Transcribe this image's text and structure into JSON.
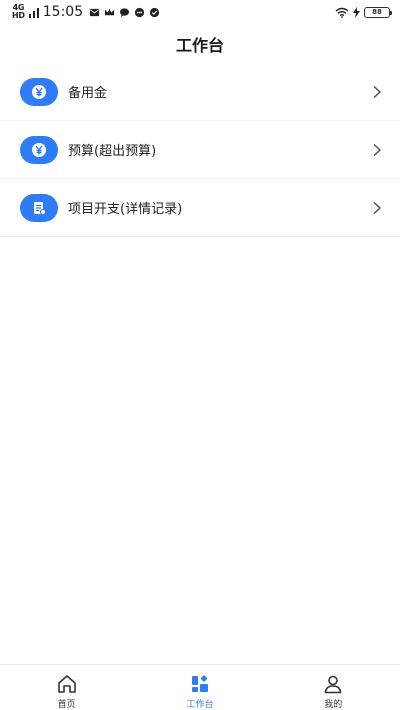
{
  "status_bar": {
    "network_top": "4G",
    "network_bottom": "HD",
    "time": "15:05",
    "battery": "88"
  },
  "header": {
    "title": "工作台"
  },
  "menu": {
    "items": [
      {
        "label": "备用金",
        "icon": "yen-coin-icon"
      },
      {
        "label": "预算(超出预算)",
        "icon": "yen-coin-icon"
      },
      {
        "label": "项目开支(详情记录)",
        "icon": "document-icon"
      }
    ]
  },
  "bottom_nav": {
    "items": [
      {
        "label": "首页",
        "icon": "home-icon"
      },
      {
        "label": "工作台",
        "icon": "workbench-grid-icon"
      },
      {
        "label": "我的",
        "icon": "user-icon"
      }
    ],
    "active": "工作台"
  },
  "colors": {
    "accent": "#2f7cf6",
    "text": "#222222",
    "divider": "#f3f3f3"
  }
}
